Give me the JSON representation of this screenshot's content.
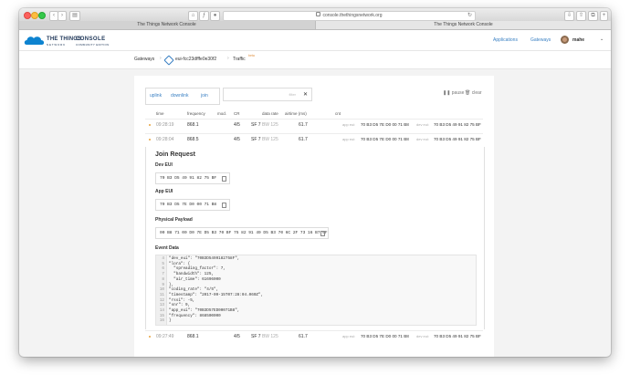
{
  "browser": {
    "url": "console.thethingsnetwork.org",
    "tabs": [
      "The Things Network Console",
      "The Things Network Console"
    ]
  },
  "app": {
    "logo_text": "THE THINGS",
    "logo_sub": "NETWORK",
    "console_title": "CONSOLE",
    "console_sub": "COMMUNITY EDITION",
    "nav": [
      "Applications",
      "Gateways"
    ],
    "user": "mahe"
  },
  "breadcrumb": {
    "gateways": "Gateways",
    "gateway_id": "eui-fcc23dfffe0e30f2",
    "traffic": "Traffic",
    "beta": "beta"
  },
  "filters": {
    "uplink": "uplink",
    "downlink": "downlink",
    "join": "join",
    "placeholder": "filter",
    "pause": "pause",
    "clear": "clear"
  },
  "columns": [
    "time",
    "frequency",
    "mod.",
    "CR",
    "data rate",
    "airtime (ms)",
    "cnt"
  ],
  "rows": [
    {
      "time": "09:28:19",
      "frequency": "868.1",
      "cr": "4/5",
      "sf": "SF 7",
      "bw": "BW 125",
      "airtime": "61.7",
      "app_eui_label": "app eui:",
      "app_eui": "70 B3 D5 7E D0 00 71 B8",
      "dev_eui_label": "dev eui:",
      "dev_eui": "70 B3 D5 49 91 82 75 BF"
    },
    {
      "time": "09:28:04",
      "frequency": "868.5",
      "cr": "4/5",
      "sf": "SF 7",
      "bw": "BW 125",
      "airtime": "61.7",
      "app_eui_label": "app eui:",
      "app_eui": "70 B3 D5 7E D0 00 71 B8",
      "dev_eui_label": "dev eui:",
      "dev_eui": "70 B3 D5 49 91 82 75 BF"
    },
    {
      "time": "09:27:49",
      "frequency": "868.1",
      "cr": "4/5",
      "sf": "SF 7",
      "bw": "BW 125",
      "airtime": "61.7",
      "app_eui_label": "app eui:",
      "app_eui": "70 B3 D5 7E D0 00 71 B8",
      "dev_eui_label": "dev eui:",
      "dev_eui": "70 B3 D5 49 91 82 75 BF"
    }
  ],
  "detail": {
    "title": "Join Request",
    "dev_eui_label": "Dev EUI",
    "dev_eui": "70 B3 D5 49 91 82 75 BF",
    "app_eui_label": "App EUI",
    "app_eui": "70 B3 D5 7E D0 00 71 B8",
    "payload_label": "Physical Payload",
    "payload": "00 B8 71 00 D0 7E D5 B3 70 BF 75 82 91 49 D5 B3 70 6C 2F 73 16 B7 0F",
    "event_label": "Event Data"
  },
  "event_lines": [
    {
      "n": "4",
      "t": "\"dev_eui\": \"70B3D5499182758F\","
    },
    {
      "n": "5",
      "t": "\"lora\": {"
    },
    {
      "n": "6",
      "t": "  \"spreading_factor\": 7,"
    },
    {
      "n": "7",
      "t": "  \"bandwidth\": 125,"
    },
    {
      "n": "8",
      "t": "  \"air_time\": 61696000"
    },
    {
      "n": "9",
      "t": "},"
    },
    {
      "n": "10",
      "t": "\"coding_rate\": \"4/5\","
    },
    {
      "n": "11",
      "t": "\"timestamp\": \"2017-09-15T07:28:04.060Z\","
    },
    {
      "n": "12",
      "t": "\"rssi\": -5,"
    },
    {
      "n": "13",
      "t": "\"snr\": 9,"
    },
    {
      "n": "14",
      "t": "\"app_eui\": \"70B3D57ED00071B8\","
    },
    {
      "n": "15",
      "t": "\"frequency\": 868500000"
    },
    {
      "n": "16",
      "t": "}"
    }
  ]
}
